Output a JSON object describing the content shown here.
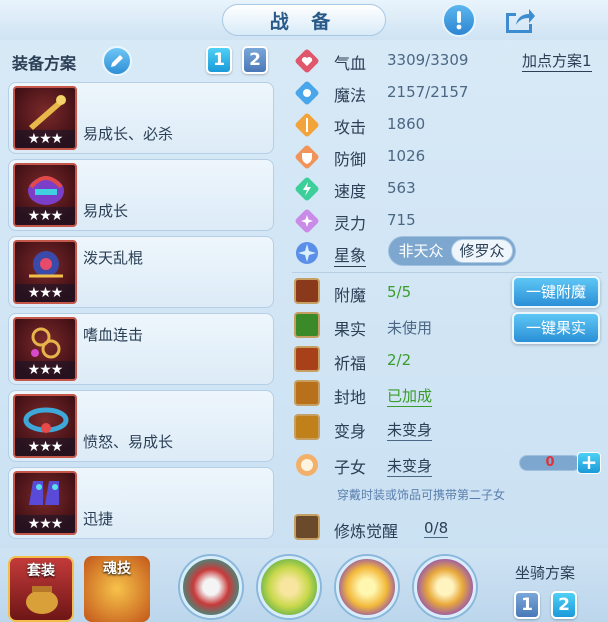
{
  "header": {
    "title": "战 备"
  },
  "equip_plan": {
    "title": "装备方案",
    "plan_buttons": [
      "1",
      "2"
    ],
    "items": [
      {
        "name": "易成长、必杀",
        "stars": "★★★"
      },
      {
        "name": "易成长",
        "stars": "★★★"
      },
      {
        "name": "泼天乱棍",
        "stars": "★★★"
      },
      {
        "name": "嗜血连击",
        "stars": "★★★"
      },
      {
        "name": "愤怒、易成长",
        "stars": "★★★"
      },
      {
        "name": "迅捷",
        "stars": "★★★"
      }
    ]
  },
  "stats": {
    "point_plan": "加点方案1",
    "rows": [
      {
        "label": "气血",
        "value": "3309/3309",
        "icon": "heart-icon",
        "color": "#e0566a"
      },
      {
        "label": "魔法",
        "value": "2157/2157",
        "icon": "mana-icon",
        "color": "#4aa6ea"
      },
      {
        "label": "攻击",
        "value": "1860",
        "icon": "sword-icon",
        "color": "#f2a33a"
      },
      {
        "label": "防御",
        "value": "1026",
        "icon": "shield-icon",
        "color": "#f2935a"
      },
      {
        "label": "速度",
        "value": "563",
        "icon": "speed-icon",
        "color": "#3ccf9a"
      },
      {
        "label": "灵力",
        "value": "715",
        "icon": "spirit-icon",
        "color": "#c98ae8"
      }
    ],
    "xingxiang": {
      "label": "星象",
      "option_a": "非天众",
      "option_b": "修罗众"
    }
  },
  "enhancements": {
    "rows": [
      {
        "label": "附魔",
        "value": "5/5",
        "button": "一键附魔"
      },
      {
        "label": "果实",
        "value": "未使用",
        "button": "一键果实"
      },
      {
        "label": "祈福",
        "value": "2/2"
      },
      {
        "label": "封地",
        "value": "已加成"
      },
      {
        "label": "变身",
        "value": "未变身"
      },
      {
        "label": "子女",
        "value": "未变身",
        "slider_value": "0"
      }
    ],
    "hint": "穿戴时装或饰品可携带第二子女",
    "awaken": {
      "label": "修炼觉醒",
      "value": "0/8"
    }
  },
  "bottom": {
    "tab_suit": "套装",
    "tab_soul": "魂技",
    "mount_title": "坐骑方案",
    "mount_buttons": [
      "1",
      "2"
    ]
  },
  "colors": {
    "accent": "#2a8fd6",
    "green": "#3a9c2a",
    "red": "#e0323a"
  }
}
